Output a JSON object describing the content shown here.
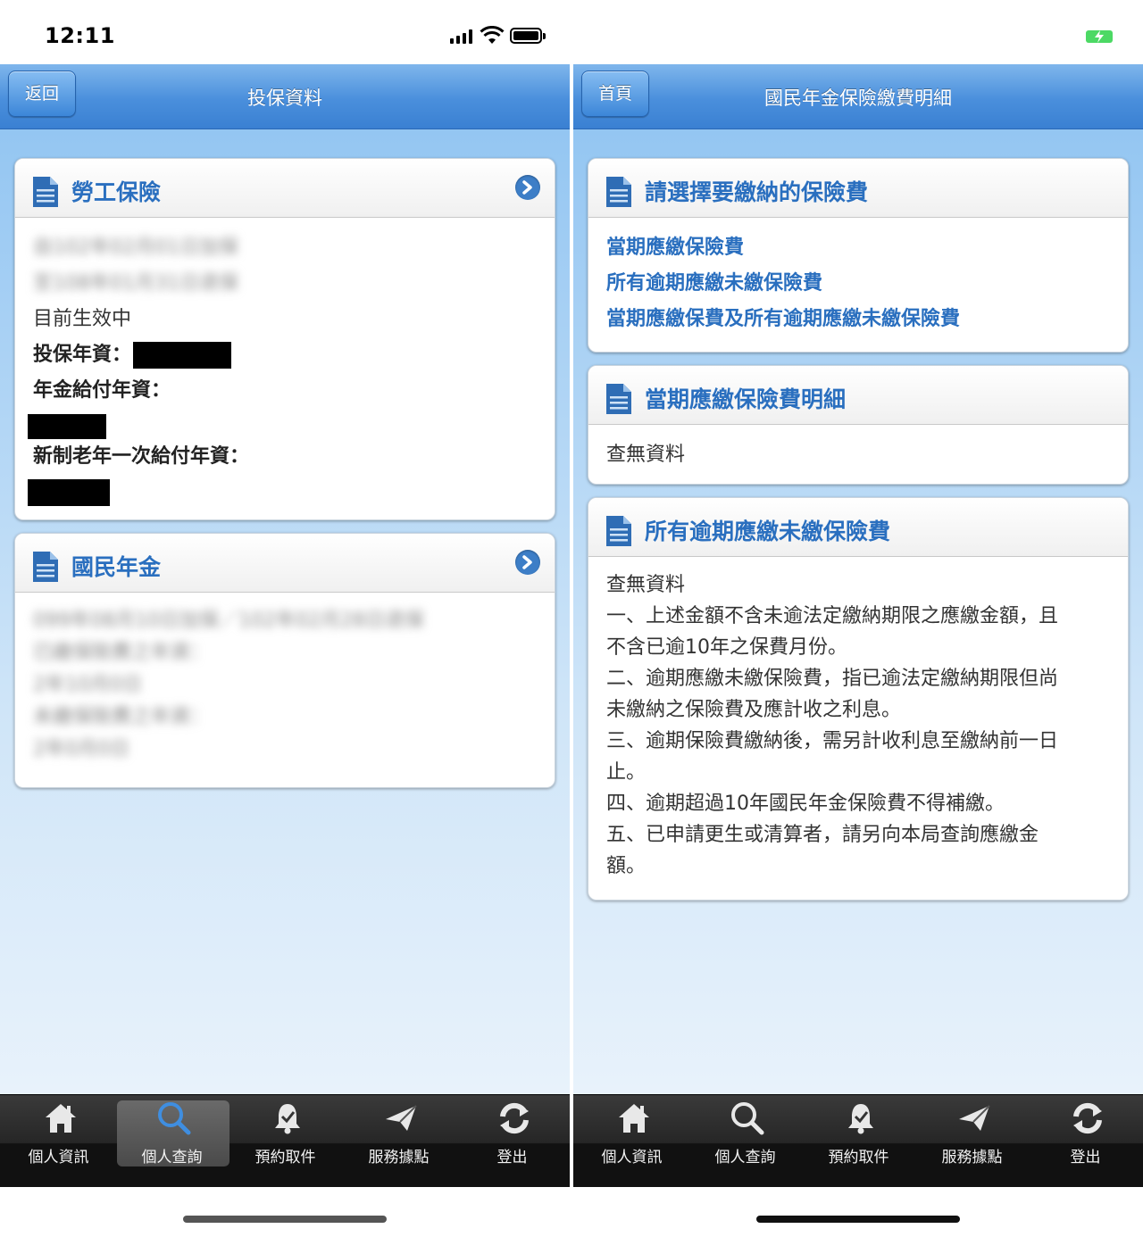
{
  "colors": {
    "accent": "#2a6fbf",
    "header": "#4a8fdc",
    "tabbar": "#1c1c1c"
  },
  "left": {
    "status": {
      "time": "12:11"
    },
    "header": {
      "back_label": "返回",
      "title": "投保資料"
    },
    "cards": {
      "labor": {
        "title": "勞工保險",
        "blur1": "自102年02月01日加保",
        "blur2": "至108年01月31日退保",
        "status": "目前生效中",
        "years_label": "投保年資：",
        "pension_label": "年金給付年資：",
        "lump_label": "新制老年一次給付年資："
      },
      "national": {
        "title": "國民年金",
        "blur1": "099年08月10日加保／102年02月28日退保",
        "blur2": "已繳保險費之年資：",
        "blur3": "2年10月0日",
        "blur4": "未繳保險費之年資：",
        "blur5": "2年0月0日"
      }
    },
    "tabs": [
      {
        "label": "個人資訊",
        "icon": "home-icon"
      },
      {
        "label": "個人查詢",
        "icon": "search-icon"
      },
      {
        "label": "預約取件",
        "icon": "bell-icon"
      },
      {
        "label": "服務據點",
        "icon": "send-icon"
      },
      {
        "label": "登出",
        "icon": "refresh-icon"
      }
    ]
  },
  "right": {
    "header": {
      "home_label": "首頁",
      "title": "國民年金保險繳費明細"
    },
    "cards": {
      "select": {
        "title": "請選擇要繳納的保險費",
        "link1": "當期應繳保險費",
        "link2": "所有逾期應繳未繳保險費",
        "link3": "當期應繳保費及所有逾期應繳未繳保險費"
      },
      "current": {
        "title": "當期應繳保險費明細",
        "body": "查無資料"
      },
      "overdue": {
        "title": "所有逾期應繳未繳保險費",
        "body": "查無資料",
        "note1a": "一、上述金額不含未逾法定繳納期限之應繳金額，且",
        "note1b": "不含已逾10年之保費月份。",
        "note2a": "二、逾期應繳未繳保險費，指已逾法定繳納期限但尚",
        "note2b": "未繳納之保險費及應計收之利息。",
        "note3a": "三、逾期保險費繳納後，需另計收利息至繳納前一日",
        "note3b": "止。",
        "note4": "四、逾期超過10年國民年金保險費不得補繳。",
        "note5a": "五、已申請更生或清算者，請另向本局查詢應繳金",
        "note5b": "額。"
      }
    },
    "tabs": [
      {
        "label": "個人資訊",
        "icon": "home-icon"
      },
      {
        "label": "個人查詢",
        "icon": "search-icon"
      },
      {
        "label": "預約取件",
        "icon": "bell-icon"
      },
      {
        "label": "服務據點",
        "icon": "send-icon"
      },
      {
        "label": "登出",
        "icon": "refresh-icon"
      }
    ]
  }
}
